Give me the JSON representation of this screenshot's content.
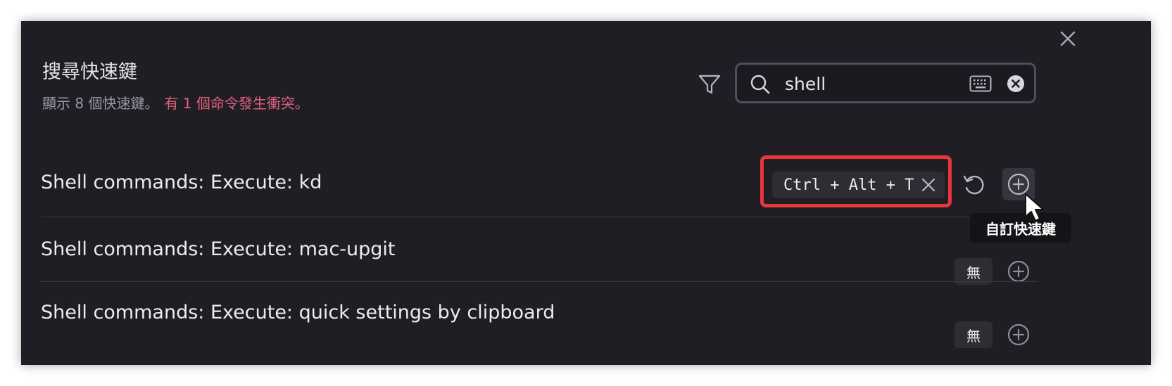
{
  "dialog": {
    "title": "搜尋快速鍵",
    "summary": "顯示 8 個快速鍵。",
    "conflict_notice": "有 1 個命令發生衝突。",
    "search_value": "shell"
  },
  "rows": [
    {
      "label": "Shell commands: Execute: kd",
      "hotkey": "Ctrl + Alt + T"
    },
    {
      "label": "Shell commands: Execute: mac-upgit",
      "hotkey": "無"
    },
    {
      "label": "Shell commands: Execute: quick settings by clipboard",
      "hotkey": "無"
    }
  ],
  "tooltip": "自訂快速鍵",
  "icons": {
    "close": "close-icon",
    "filter": "filter-icon",
    "search": "search-icon",
    "keyboard": "keyboard-icon",
    "clear": "clear-icon",
    "remove_hotkey": "x-icon",
    "reset": "restore-icon",
    "add": "plus-circle-icon"
  },
  "colors": {
    "panel_bg": "#1f1e24",
    "conflict_text": "#e0607e",
    "highlight_border": "#e7353c"
  }
}
